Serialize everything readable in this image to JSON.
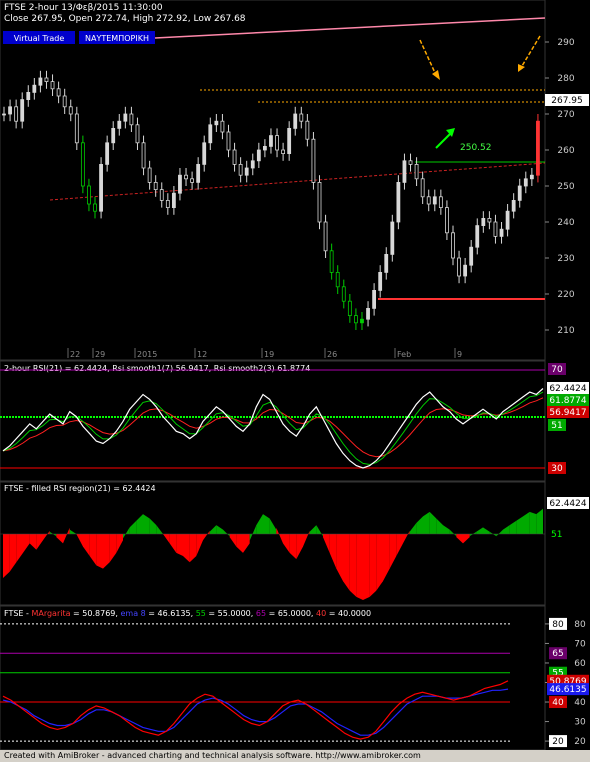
{
  "colors": {
    "background": "#000000",
    "price_up": "#d8d8d8",
    "price_highlight_green": "#00cc00",
    "price_red": "#ff3333",
    "rsi_line": "#ffffff",
    "smooth1": "#ff2020",
    "smooth2": "#00cc00",
    "rsi_fill_up": "#00aa00",
    "rsi_fill_down": "#ff0000",
    "margarita": "#ff0000",
    "ema": "#2222ff",
    "level55": "#00cc00",
    "level65": "#aa00aa",
    "level40": "#ff0000",
    "pink_trend": "#ff88aa",
    "orange_guide": "#ffaa00",
    "footer_bg": "#d4d0c8"
  },
  "header": {
    "line1": "FTSE  2-hour  13/Φεβ/2015 11:30:00",
    "line2": "Close 267.95, Open 272.74, High 272.92, Low 267.68"
  },
  "buttons": {
    "virtual": "Virtual Trade",
    "naytemporiki": "ΝΑΥΤΕΜΠΟΡΙΚΗ"
  },
  "annotations": {
    "breakout_label": "250.52"
  },
  "footer": {
    "text": "Created with AmiBroker - advanced charting and technical analysis software. http://www.amibroker.com"
  },
  "chart_data": [
    {
      "type": "candlestick",
      "title": "FTSE  2-hour",
      "x_labels": [
        "22",
        "29",
        "2015",
        "12",
        "19",
        "26",
        "Feb",
        "9"
      ],
      "ylim": [
        205,
        295
      ],
      "y_ticks": [
        210,
        220,
        230,
        240,
        250,
        260,
        270,
        280,
        290
      ],
      "last_price": 267.95,
      "breakout_level": 250.52,
      "close_series": [
        270,
        272,
        268,
        274,
        276,
        278,
        280,
        279,
        277,
        275,
        272,
        270,
        262,
        250,
        245,
        243,
        256,
        262,
        266,
        268,
        270,
        267,
        262,
        255,
        251,
        249,
        246,
        244,
        248,
        253,
        252,
        251,
        256,
        262,
        267,
        268,
        265,
        260,
        256,
        253,
        255,
        257,
        260,
        261,
        264,
        260,
        259,
        266,
        270,
        268,
        263,
        251,
        240,
        232,
        226,
        222,
        218,
        214,
        212,
        213,
        216,
        221,
        226,
        231,
        240,
        251,
        257,
        256,
        252,
        247,
        245,
        247,
        244,
        237,
        230,
        225,
        228,
        233,
        239,
        241,
        240,
        236,
        238,
        243,
        246,
        250,
        252,
        253,
        268
      ]
    },
    {
      "type": "line",
      "title": "2-hour RSI(21) = 62.4424, Rsi smooth1(7) 56.9417, Rsi smooth2(3) 61.8774",
      "ylim": [
        25,
        72
      ],
      "levels": [
        70,
        51,
        30
      ],
      "series": [
        {
          "name": "RSI(21)",
          "last": 62.4424
        },
        {
          "name": "Rsi smooth1(7)",
          "last": 56.9417
        },
        {
          "name": "Rsi smooth2(3)",
          "last": 61.8774
        }
      ],
      "rsi_series": [
        37,
        39,
        42,
        45,
        48,
        46,
        49,
        52,
        50,
        48,
        53,
        51,
        47,
        44,
        41,
        40,
        42,
        45,
        49,
        54,
        57,
        60,
        58,
        55,
        51,
        48,
        45,
        44,
        42,
        44,
        49,
        52,
        55,
        53,
        50,
        47,
        45,
        48,
        55,
        60,
        58,
        53,
        48,
        45,
        43,
        47,
        52,
        55,
        50,
        45,
        40,
        36,
        33,
        31,
        30,
        31,
        33,
        36,
        40,
        44,
        48,
        52,
        56,
        59,
        61,
        58,
        55,
        53,
        50,
        48,
        50,
        52,
        54,
        52,
        50,
        53,
        55,
        57,
        59,
        61,
        60,
        62.44
      ]
    },
    {
      "type": "area",
      "title": "FTSE - filled RSI region(21) = 62.4424",
      "baseline": 51,
      "last": 62.4424
    },
    {
      "type": "line",
      "title": "FTSE - MArgarita = 50.8769, ema 8 = 46.6135, 55 = 55.0000, 65 = 65.0000, 40 = 40.0000",
      "ylim": [
        18,
        82
      ],
      "y_ticks": [
        20,
        30,
        40,
        50,
        60,
        70,
        80
      ],
      "levels": [
        80,
        65,
        55,
        40,
        20
      ],
      "series": [
        {
          "name": "MArgarita",
          "last": 50.8769
        },
        {
          "name": "ema 8",
          "last": 46.6135
        }
      ],
      "margarita_series": [
        43,
        41,
        38,
        35,
        32,
        29,
        27,
        26,
        27,
        29,
        33,
        36,
        38,
        37,
        35,
        33,
        30,
        27,
        25,
        24,
        23,
        25,
        29,
        34,
        39,
        42,
        44,
        43,
        40,
        37,
        34,
        31,
        29,
        28,
        30,
        34,
        38,
        40,
        41,
        39,
        36,
        33,
        30,
        27,
        24,
        22,
        21,
        22,
        25,
        30,
        35,
        39,
        42,
        44,
        45,
        44,
        43,
        42,
        41,
        42,
        43,
        45,
        47,
        48,
        49,
        50.88
      ],
      "ema_series": [
        41,
        40,
        38,
        36,
        33,
        31,
        29,
        28,
        28,
        29,
        31,
        34,
        36,
        36,
        35,
        33,
        31,
        29,
        27,
        26,
        25,
        25,
        27,
        31,
        35,
        39,
        41,
        42,
        41,
        39,
        36,
        33,
        31,
        30,
        30,
        32,
        35,
        38,
        39,
        39,
        37,
        35,
        32,
        29,
        27,
        25,
        23,
        23,
        24,
        27,
        31,
        35,
        39,
        41,
        43,
        43,
        43,
        42,
        42,
        42,
        43,
        44,
        45,
        46,
        46,
        46.61
      ]
    }
  ]
}
